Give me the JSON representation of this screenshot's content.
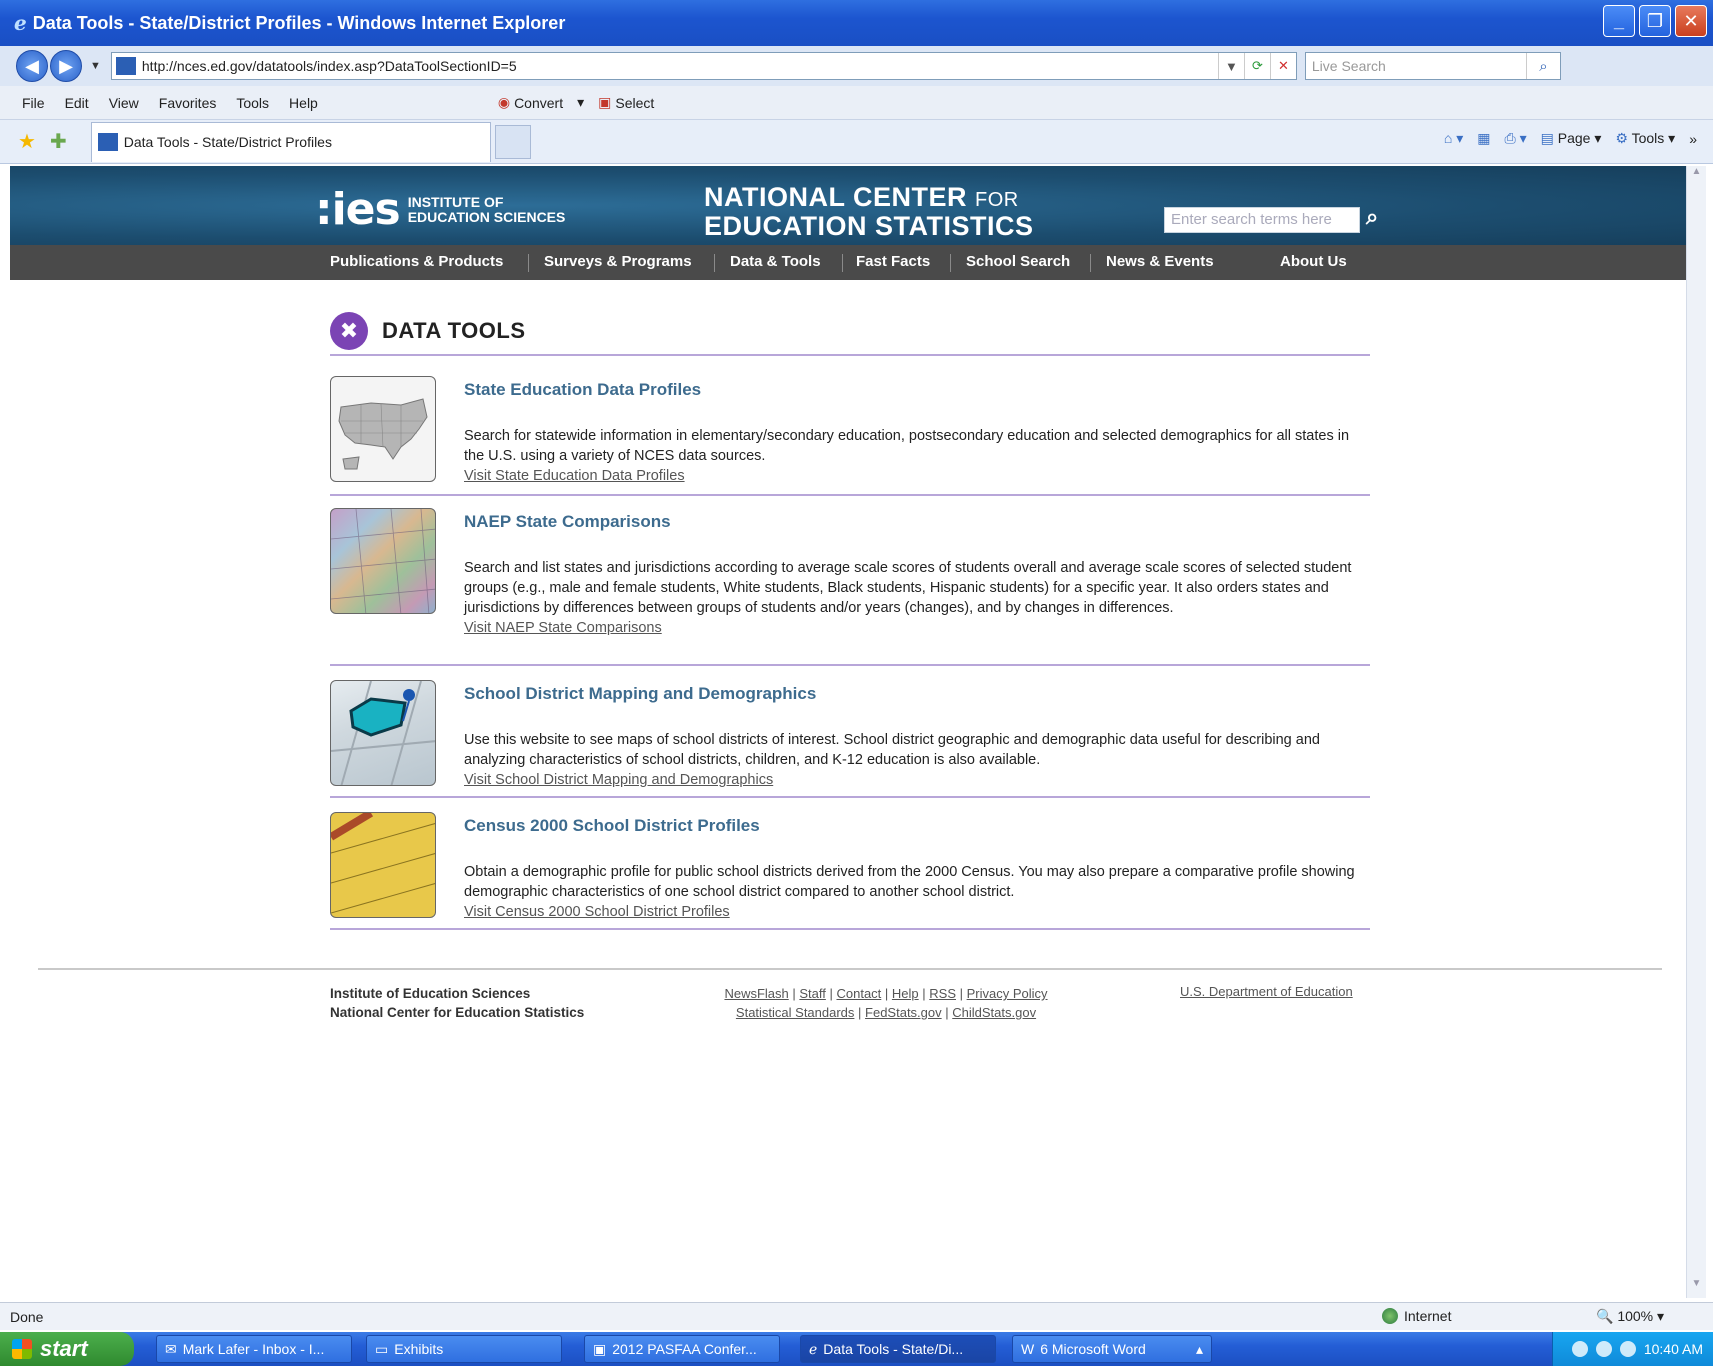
{
  "window": {
    "title": "Data Tools - State/District Profiles - Windows Internet Explorer",
    "buttons": [
      "_",
      "❐",
      "✕"
    ]
  },
  "address_bar": {
    "url": "http://nces.ed.gov/datatools/index.asp?DataToolSectionID=5",
    "search_placeholder": "Live Search"
  },
  "menu": {
    "items": [
      "File",
      "Edit",
      "View",
      "Favorites",
      "Tools",
      "Help"
    ],
    "convert": "Convert",
    "select": "Select"
  },
  "tabs": {
    "active": "Data Tools - State/District Profiles"
  },
  "command_bar": {
    "page": "Page",
    "tools": "Tools"
  },
  "site": {
    "ies_big": ":ies",
    "ies_line1": "Institute of",
    "ies_line2": "Education Sciences",
    "nces_line1": "NATIONAL CENTER",
    "nces_for": "FOR",
    "nces_line2": "EDUCATION STATISTICS",
    "search_placeholder": "Enter search terms here",
    "nav": [
      "Publications & Products",
      "Surveys & Programs",
      "Data & Tools",
      "Fast Facts",
      "School Search",
      "News & Events",
      "About Us"
    ]
  },
  "section": {
    "title": "DATA TOOLS"
  },
  "tools": [
    {
      "title": "State Education Data Profiles",
      "description": "Search for statewide information in elementary/secondary education, postsecondary education and selected demographics for all states in the U.S. using a variety of NCES data sources.",
      "link": "Visit State Education Data Profiles"
    },
    {
      "title": "NAEP State Comparisons",
      "description": "Search and list states and jurisdictions according to average scale scores of students overall and average scale scores of selected student groups (e.g., male and female students, White students, Black students, Hispanic students) for a specific year. It also orders states and jurisdictions by differences between groups of students and/or years (changes), and by changes in differences.",
      "link": "Visit NAEP State Comparisons"
    },
    {
      "title": "School District Mapping and Demographics",
      "description": "Use this website to see maps of school districts of interest. School district geographic and demographic data useful for describing and analyzing characteristics of school districts, children, and K-12 education is also available.",
      "link": "Visit School District Mapping and Demographics"
    },
    {
      "title": "Census 2000 School District Profiles",
      "description": "Obtain a demographic profile for public school districts derived from the 2000 Census. You may also prepare a comparative profile showing demographic characteristics of one school district compared to another school district.",
      "link": "Visit Census 2000 School District Profiles"
    }
  ],
  "footer": {
    "org1": "Institute of Education Sciences",
    "org2": "National Center for Education Statistics",
    "links_row1": [
      "NewsFlash",
      "Staff",
      "Contact",
      "Help",
      "RSS",
      "Privacy Policy"
    ],
    "links_row2": [
      "Statistical Standards",
      "FedStats.gov",
      "ChildStats.gov"
    ],
    "dept": "U.S. Department of Education"
  },
  "status": {
    "text": "Done",
    "zone": "Internet",
    "zoom": "100%"
  },
  "taskbar": {
    "start": "start",
    "items": [
      "Mark Lafer - Inbox - I...",
      "Exhibits",
      "2012 PASFAA Confer...",
      "Data Tools - State/Di...",
      "6 Microsoft Word"
    ],
    "clock": "10:40 AM"
  }
}
